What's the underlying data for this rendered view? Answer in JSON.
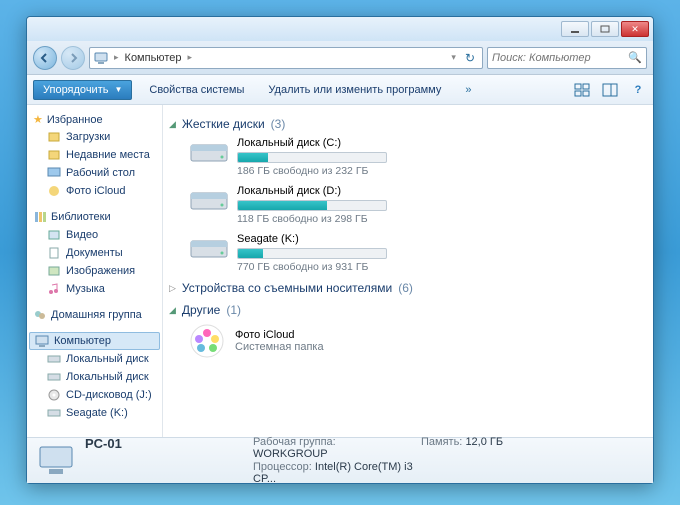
{
  "window_controls": {
    "min": "_",
    "max": "☐",
    "close": "✕"
  },
  "address": {
    "root_icon": "computer-icon",
    "crumb": "Компьютер",
    "refresh": "↻"
  },
  "search": {
    "placeholder": "Поиск: Компьютер"
  },
  "toolbar": {
    "organize": "Упорядочить",
    "properties": "Свойства системы",
    "uninstall": "Удалить или изменить программу",
    "overflow": "»"
  },
  "sidebar": {
    "favorites": {
      "label": "Избранное",
      "items": [
        {
          "icon": "downloads",
          "label": "Загрузки"
        },
        {
          "icon": "recent",
          "label": "Недавние места"
        },
        {
          "icon": "desktop",
          "label": "Рабочий стол"
        },
        {
          "icon": "icloud",
          "label": "Фото iCloud"
        }
      ]
    },
    "libraries": {
      "label": "Библиотеки",
      "items": [
        {
          "icon": "video",
          "label": "Видео"
        },
        {
          "icon": "docs",
          "label": "Документы"
        },
        {
          "icon": "pics",
          "label": "Изображения"
        },
        {
          "icon": "music",
          "label": "Музыка"
        }
      ]
    },
    "homegroup": {
      "label": "Домашняя группа"
    },
    "computer": {
      "label": "Компьютер",
      "items": [
        {
          "icon": "hdd",
          "label": "Локальный диск"
        },
        {
          "icon": "hdd",
          "label": "Локальный диск"
        },
        {
          "icon": "cd",
          "label": "CD-дисковод (J:)"
        },
        {
          "icon": "hdd",
          "label": "Seagate (K:)"
        }
      ]
    }
  },
  "categories": {
    "hdd": {
      "label": "Жесткие диски",
      "count": "(3)"
    },
    "remov": {
      "label": "Устройства со съемными носителями",
      "count": "(6)"
    },
    "other": {
      "label": "Другие",
      "count": "(1)"
    }
  },
  "drives": [
    {
      "name": "Локальный диск (C:)",
      "fill_pct": 20,
      "free": "186 ГБ свободно из 232 ГБ"
    },
    {
      "name": "Локальный диск (D:)",
      "fill_pct": 60,
      "free": "118 ГБ свободно из 298 ГБ"
    },
    {
      "name": "Seagate (K:)",
      "fill_pct": 17,
      "free": "770 ГБ свободно из 931 ГБ"
    }
  ],
  "other_items": [
    {
      "name": "Фото iCloud",
      "sub": "Системная папка"
    }
  ],
  "status": {
    "pc": "PC-01",
    "wg_label": "Рабочая группа:",
    "wg_val": "WORKGROUP",
    "mem_label": "Память:",
    "mem_val": "12,0 ГБ",
    "cpu_label": "Процессор:",
    "cpu_val": "Intel(R) Core(TM) i3 CP..."
  }
}
